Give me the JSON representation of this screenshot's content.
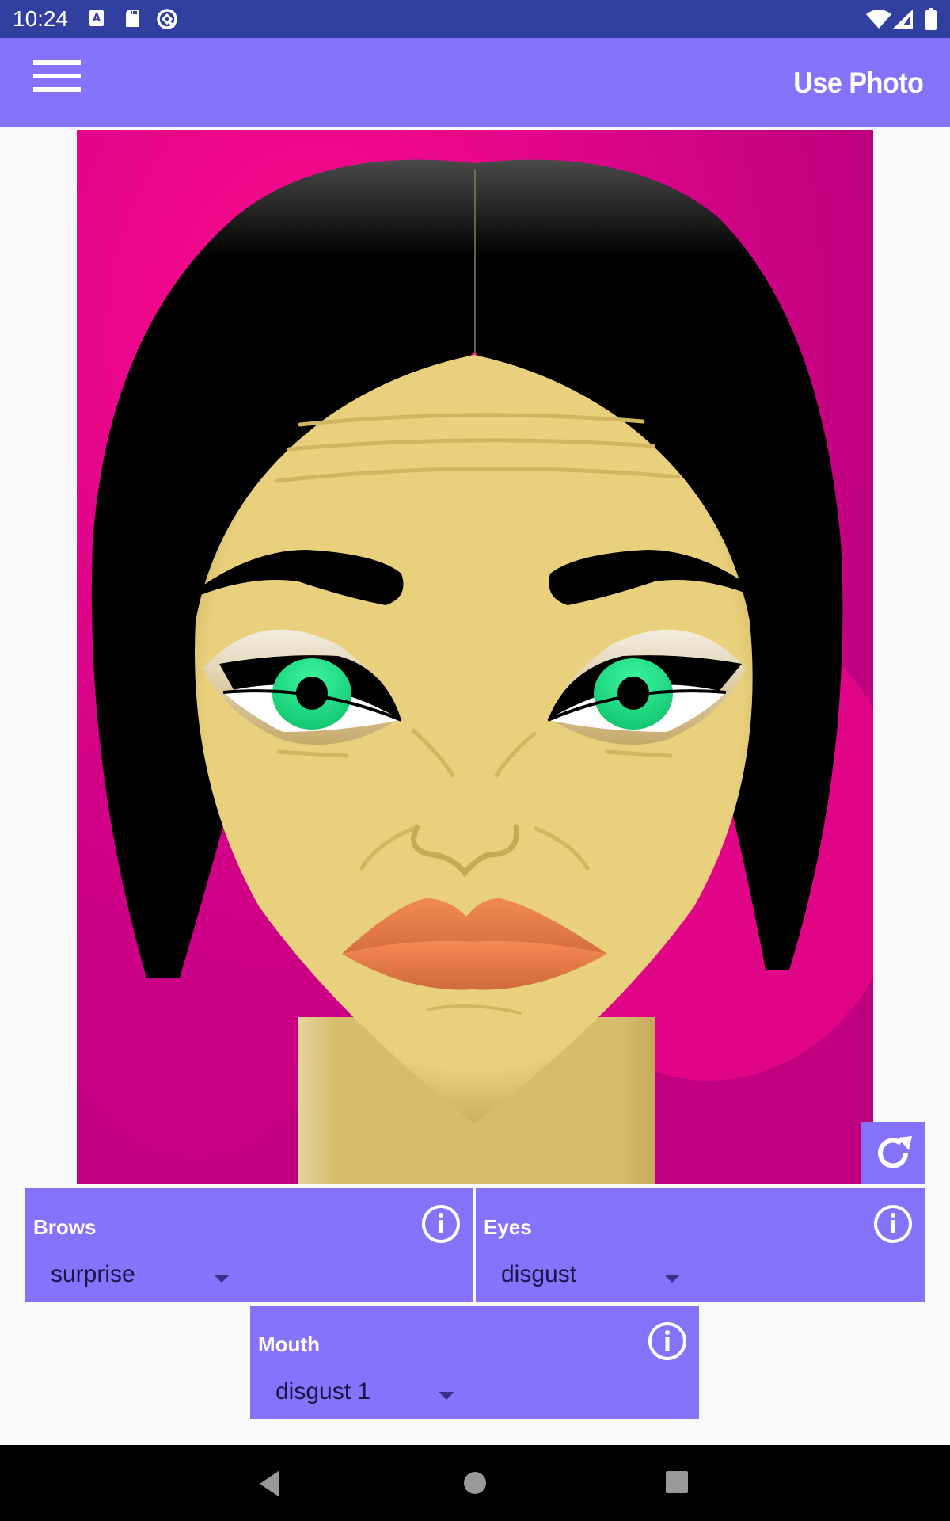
{
  "status_bar": {
    "time": "10:24",
    "left_icons": [
      "keyboard-a-icon",
      "sd-card-icon",
      "q-beta-icon"
    ],
    "right_icons": [
      "wifi-icon",
      "signal-icon",
      "battery-icon"
    ]
  },
  "app_bar": {
    "menu_icon": "hamburger-menu-icon",
    "action_label": "Use Photo"
  },
  "canvas": {
    "description": "Cartoon face with black hair, green eyes, orange lips on pink background",
    "colors": {
      "background": "#f7068a",
      "skin": "#e9d07c",
      "hair": "#000000",
      "iris": "#22e88a",
      "lips": "#ee8650"
    },
    "refresh_icon": "refresh-icon"
  },
  "controls": {
    "brows": {
      "label": "Brows",
      "value": "surprise",
      "info_icon": "info-icon"
    },
    "eyes": {
      "label": "Eyes",
      "value": "disgust",
      "info_icon": "info-icon"
    },
    "mouth": {
      "label": "Mouth",
      "value": "disgust 1",
      "info_icon": "info-icon"
    }
  },
  "theme": {
    "primary": "#8573fc",
    "status_bar": "#3140a0",
    "nav_bar": "#000000"
  },
  "nav_bar": {
    "buttons": [
      "back-icon",
      "home-icon",
      "recents-icon"
    ]
  }
}
